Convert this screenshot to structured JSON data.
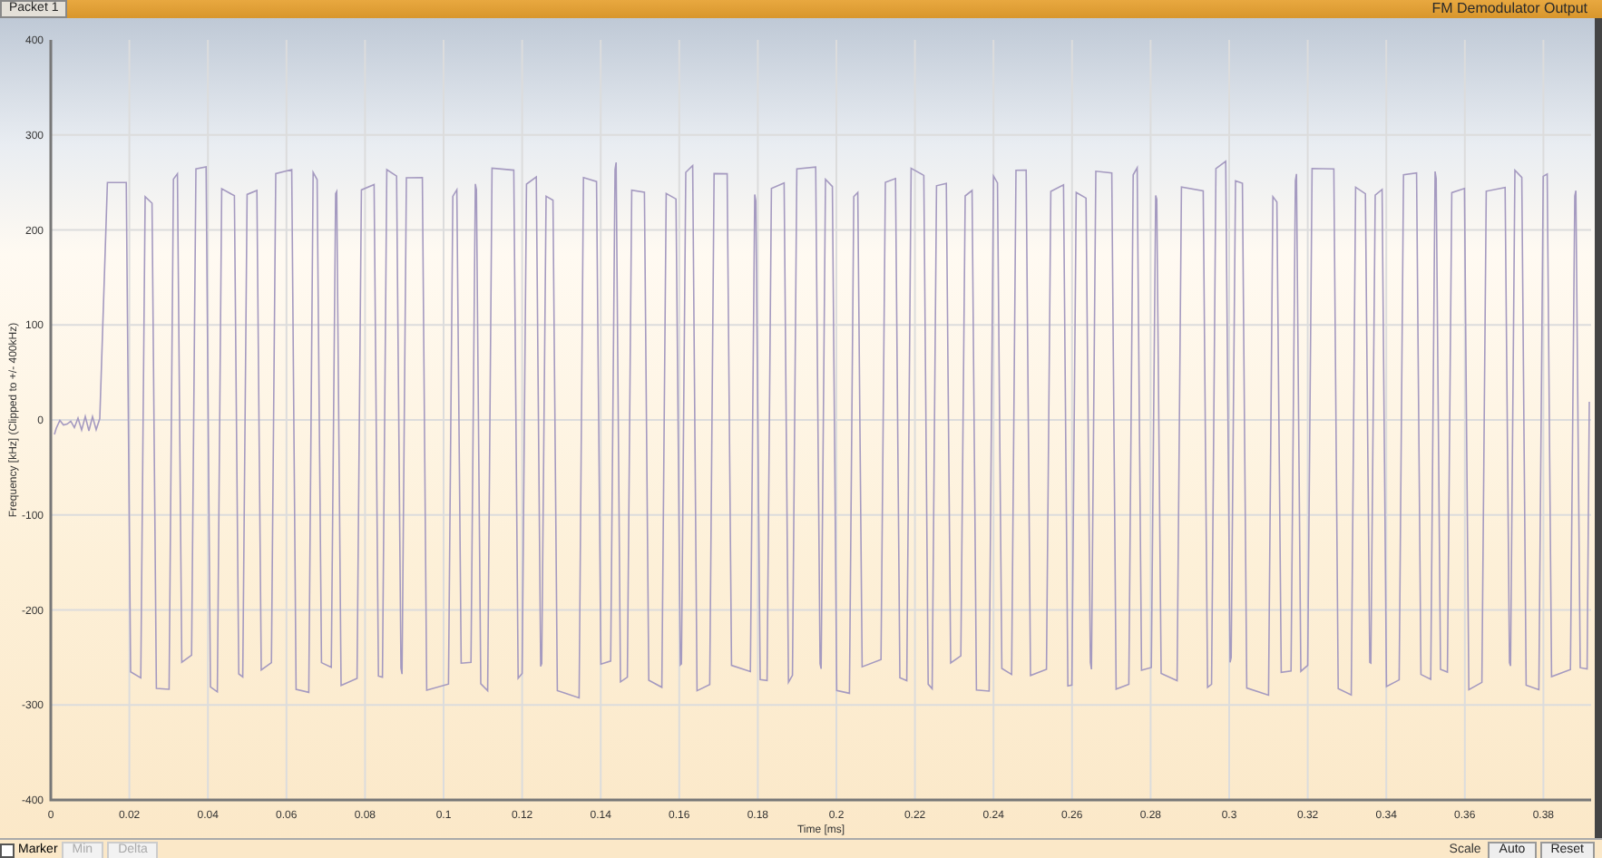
{
  "header": {
    "tab": "Packet 1",
    "title": "FM Demodulator Output"
  },
  "chart": {
    "ylabel": "Frequency [kHz] (Clipped to +/- 400kHz)",
    "xlabel": "Time [ms]",
    "yticks": [
      "400",
      "300",
      "200",
      "100",
      "0",
      "-100",
      "-200",
      "-300",
      "-400"
    ],
    "xticks": [
      "0",
      "0.02",
      "0.04",
      "0.06",
      "0.08",
      "0.1",
      "0.12",
      "0.14",
      "0.16",
      "0.18",
      "0.2",
      "0.22",
      "0.24",
      "0.26",
      "0.28",
      "0.3",
      "0.32",
      "0.34",
      "0.36",
      "0.38"
    ]
  },
  "controls": {
    "marker": {
      "label": "Marker",
      "checked": false
    },
    "buttons": [
      {
        "label": "Min",
        "disabled": true
      },
      {
        "label": "Delta",
        "disabled": true
      }
    ],
    "scale_label": "Scale",
    "scale_buttons": [
      {
        "label": "Auto",
        "disabled": false
      },
      {
        "label": "Reset",
        "disabled": false
      }
    ]
  }
}
